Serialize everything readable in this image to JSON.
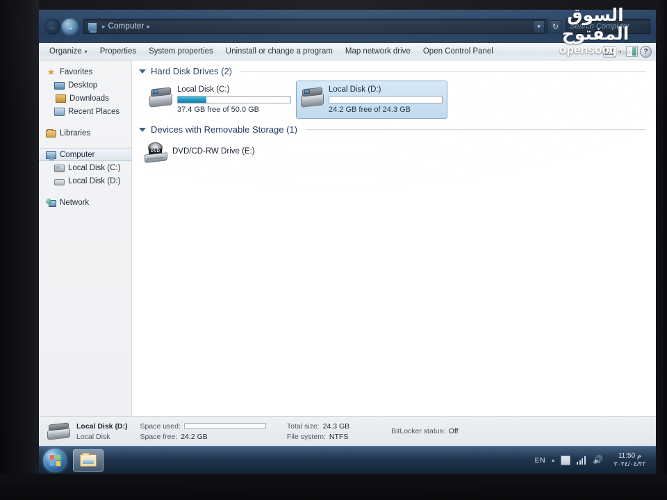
{
  "window": {
    "address": {
      "crumb_icon": "computer-icon",
      "crumb": "Computer",
      "sep1": "▸",
      "sep2": "▸",
      "dropdown_glyph": "▾",
      "refresh_glyph": "↻"
    },
    "search": {
      "placeholder": "Search Computer",
      "value": ""
    },
    "nav": {
      "back_glyph": "←",
      "forward_glyph": "→"
    }
  },
  "toolbar": {
    "items": [
      {
        "label": "Organize",
        "has_caret": true,
        "caret": "▾"
      },
      {
        "label": "Properties",
        "has_caret": false
      },
      {
        "label": "System properties",
        "has_caret": false
      },
      {
        "label": "Uninstall or change a program",
        "has_caret": false
      },
      {
        "label": "Map network drive",
        "has_caret": false
      },
      {
        "label": "Open Control Panel",
        "has_caret": false
      }
    ],
    "view_caret": "▾",
    "help_label": "?"
  },
  "sidebar": {
    "items": [
      {
        "label": "Favorites",
        "icon": "star-icon",
        "level": 0,
        "selected": false
      },
      {
        "label": "Desktop",
        "icon": "desktop-icon",
        "level": 1,
        "selected": false
      },
      {
        "label": "Downloads",
        "icon": "downloads-icon",
        "level": 1,
        "selected": false
      },
      {
        "label": "Recent Places",
        "icon": "recent-places-icon",
        "level": 1,
        "selected": false
      },
      {
        "label": "Libraries",
        "icon": "libraries-icon",
        "level": 0,
        "selected": false
      },
      {
        "label": "Computer",
        "icon": "computer-icon",
        "level": 0,
        "selected": true
      },
      {
        "label": "Local Disk (C:)",
        "icon": "hard-disk-icon",
        "level": 1,
        "selected": false
      },
      {
        "label": "Local Disk (D:)",
        "icon": "hard-disk-icon",
        "level": 1,
        "selected": false
      },
      {
        "label": "Network",
        "icon": "network-icon",
        "level": 0,
        "selected": false
      }
    ]
  },
  "content": {
    "groups": [
      {
        "title": "Hard Disk Drives (2)",
        "collapse_glyph": "▴",
        "items": [
          {
            "name": "Local Disk (C:)",
            "capacity_text": "37.4 GB free of 50.0 GB",
            "used_percent": 25,
            "selected": false,
            "icon": "hard-disk-icon"
          },
          {
            "name": "Local Disk (D:)",
            "capacity_text": "24.2 GB free of 24.3 GB",
            "used_percent": 0,
            "selected": true,
            "icon": "hard-disk-icon"
          }
        ]
      },
      {
        "title": "Devices with Removable Storage (1)",
        "collapse_glyph": "▴",
        "items": [
          {
            "name": "DVD/CD-RW Drive (E:)",
            "icon": "dvd-drive-icon",
            "label": "DVD"
          }
        ]
      }
    ]
  },
  "details": {
    "name": "Local Disk (D:)",
    "type": "Local Disk",
    "space_used_label": "Space used:",
    "space_used_percent": 0,
    "space_free_label": "Space free:",
    "space_free_value": "24.2 GB",
    "total_size_label": "Total size:",
    "total_size_value": "24.3 GB",
    "file_system_label": "File system:",
    "file_system_value": "NTFS",
    "bitlocker_label": "BitLocker status:",
    "bitlocker_value": "Off"
  },
  "taskbar": {
    "start_name": "start-orb",
    "buttons": [
      {
        "label": "",
        "icon": "explorer-folder-icon"
      }
    ],
    "tray": {
      "language": "EN",
      "show_hidden_glyph": "▴",
      "icons": [
        "action-center-icon",
        "network-signal-icon",
        "volume-icon"
      ],
      "speaker_glyph": "🔈",
      "time": "11:50 م",
      "date": "٢٠٢٤/٠٤/٢٢"
    }
  },
  "watermark": {
    "arabic": "السوق المفتوح",
    "latin": "opensooq",
    "tld": ".com"
  },
  "colors": {
    "accent": "#1d5d97",
    "selection": "#bcd9f0",
    "bar_fill": "#139cc9",
    "chrome": "#27436a"
  }
}
